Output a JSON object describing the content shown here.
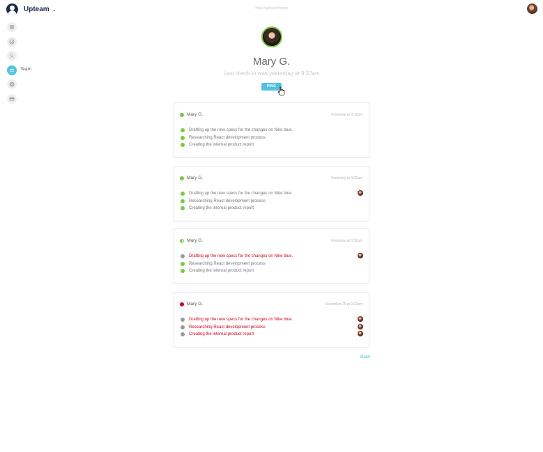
{
  "header": {
    "brand": "Upteam",
    "url": "http://upteam/marg",
    "brand_caret": "⌄"
  },
  "sidebar": {
    "items": [
      {
        "icon": "list-icon"
      },
      {
        "icon": "check-circle-icon"
      },
      {
        "icon": "user-icon"
      },
      {
        "icon": "team-icon",
        "label": "Team",
        "active": true
      },
      {
        "icon": "target-icon"
      },
      {
        "icon": "card-icon"
      }
    ]
  },
  "profile": {
    "name": "Mary G.",
    "last_checkin": "Last check-in was yesterday at 9:32am",
    "ping_label": "PING"
  },
  "cards": [
    {
      "user": "Mary G.",
      "time": "Yesterday at 9:32am",
      "status": "green",
      "tasks": [
        {
          "text": "Drafting up the new specs for the changes on Nike blue.",
          "status": "green",
          "alert": false,
          "avatar": false
        },
        {
          "text": "Researching React development process",
          "status": "green",
          "alert": false,
          "avatar": false
        },
        {
          "text": "Creating the internal product report",
          "status": "green",
          "alert": false,
          "avatar": false
        }
      ]
    },
    {
      "user": "Mary G.",
      "time": "Yesterday at 9:32am",
      "status": "green",
      "tasks": [
        {
          "text": "Drafting up the new specs for the changes on Nike blue.",
          "status": "green",
          "alert": false,
          "avatar": true
        },
        {
          "text": "Researching React development process",
          "status": "green",
          "alert": false,
          "avatar": false
        },
        {
          "text": "Creating the internal product report",
          "status": "green",
          "alert": false,
          "avatar": false
        }
      ]
    },
    {
      "user": "Mary G.",
      "time": "Yesterday at 9:32am",
      "status": "half",
      "tasks": [
        {
          "text": "Drafting up the new specs for the changes on Nike blue.",
          "status": "grey",
          "alert": true,
          "avatar": true
        },
        {
          "text": "Researching React development process",
          "status": "green",
          "alert": false,
          "avatar": false
        },
        {
          "text": "Creating the internal product report",
          "status": "green",
          "alert": false,
          "avatar": false
        }
      ]
    },
    {
      "user": "Mary G.",
      "time": "December 25 at 9:32am",
      "status": "red",
      "tasks": [
        {
          "text": "Drafting up the new specs for the changes on Nike blue.",
          "status": "grey",
          "alert": true,
          "avatar": true
        },
        {
          "text": "Researching React development process",
          "status": "grey",
          "alert": true,
          "avatar": true
        },
        {
          "text": "Creating the internal product report",
          "status": "grey",
          "alert": true,
          "avatar": true
        }
      ]
    }
  ],
  "footer": {
    "back_label": "Back"
  },
  "colors": {
    "accent": "#4fc3e1",
    "brand": "#1d2a4d",
    "ok": "#7ac943",
    "alert": "#d0021b",
    "idle": "#9b9b9b"
  }
}
